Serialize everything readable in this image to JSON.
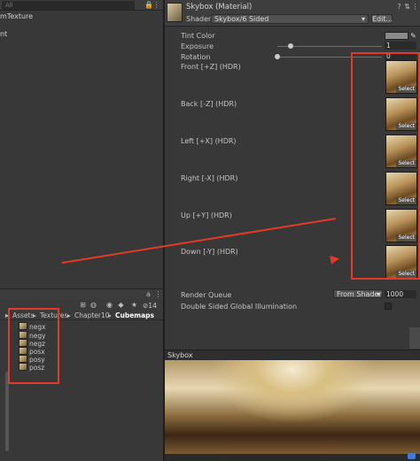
{
  "left_panel": {
    "search_placeholder": "All",
    "item_fragment": "mTexture",
    "line_fragment": "nt"
  },
  "inspector": {
    "title": "Skybox (Material)",
    "shader_label": "Shader",
    "shader_value": "Skybox/6 Sided",
    "edit_label": "Edit...",
    "tint_label": "Tint Color",
    "exposure_label": "Exposure",
    "exposure_value": "1",
    "exposure_fraction": 0.125,
    "rotation_label": "Rotation",
    "rotation_value": "0",
    "rotation_fraction": 0.0,
    "faces": [
      {
        "label": "Front [+Z]   (HDR)",
        "select": "Select"
      },
      {
        "label": "Back [-Z]   (HDR)",
        "select": "Select"
      },
      {
        "label": "Left [+X]   (HDR)",
        "select": "Select"
      },
      {
        "label": "Right [-X]   (HDR)",
        "select": "Select"
      },
      {
        "label": "Up [+Y]   (HDR)",
        "select": "Select"
      },
      {
        "label": "Down [-Y]   (HDR)",
        "select": "Select"
      }
    ],
    "render_queue_label": "Render Queue",
    "render_queue_mode": "From Shader",
    "render_queue_value": "1000",
    "dsgi_label": "Double Sided Global Illumination"
  },
  "project": {
    "toolbar_count": "14",
    "breadcrumbs": [
      "Assets",
      "Textures",
      "Chapter10",
      "Cubemaps"
    ],
    "files": [
      "negx",
      "negy",
      "negz",
      "posx",
      "posy",
      "posz"
    ]
  },
  "preview": {
    "title": "Skybox"
  },
  "colors": {
    "annotation_red": "#e53a2a",
    "panel_bg": "#383838"
  }
}
